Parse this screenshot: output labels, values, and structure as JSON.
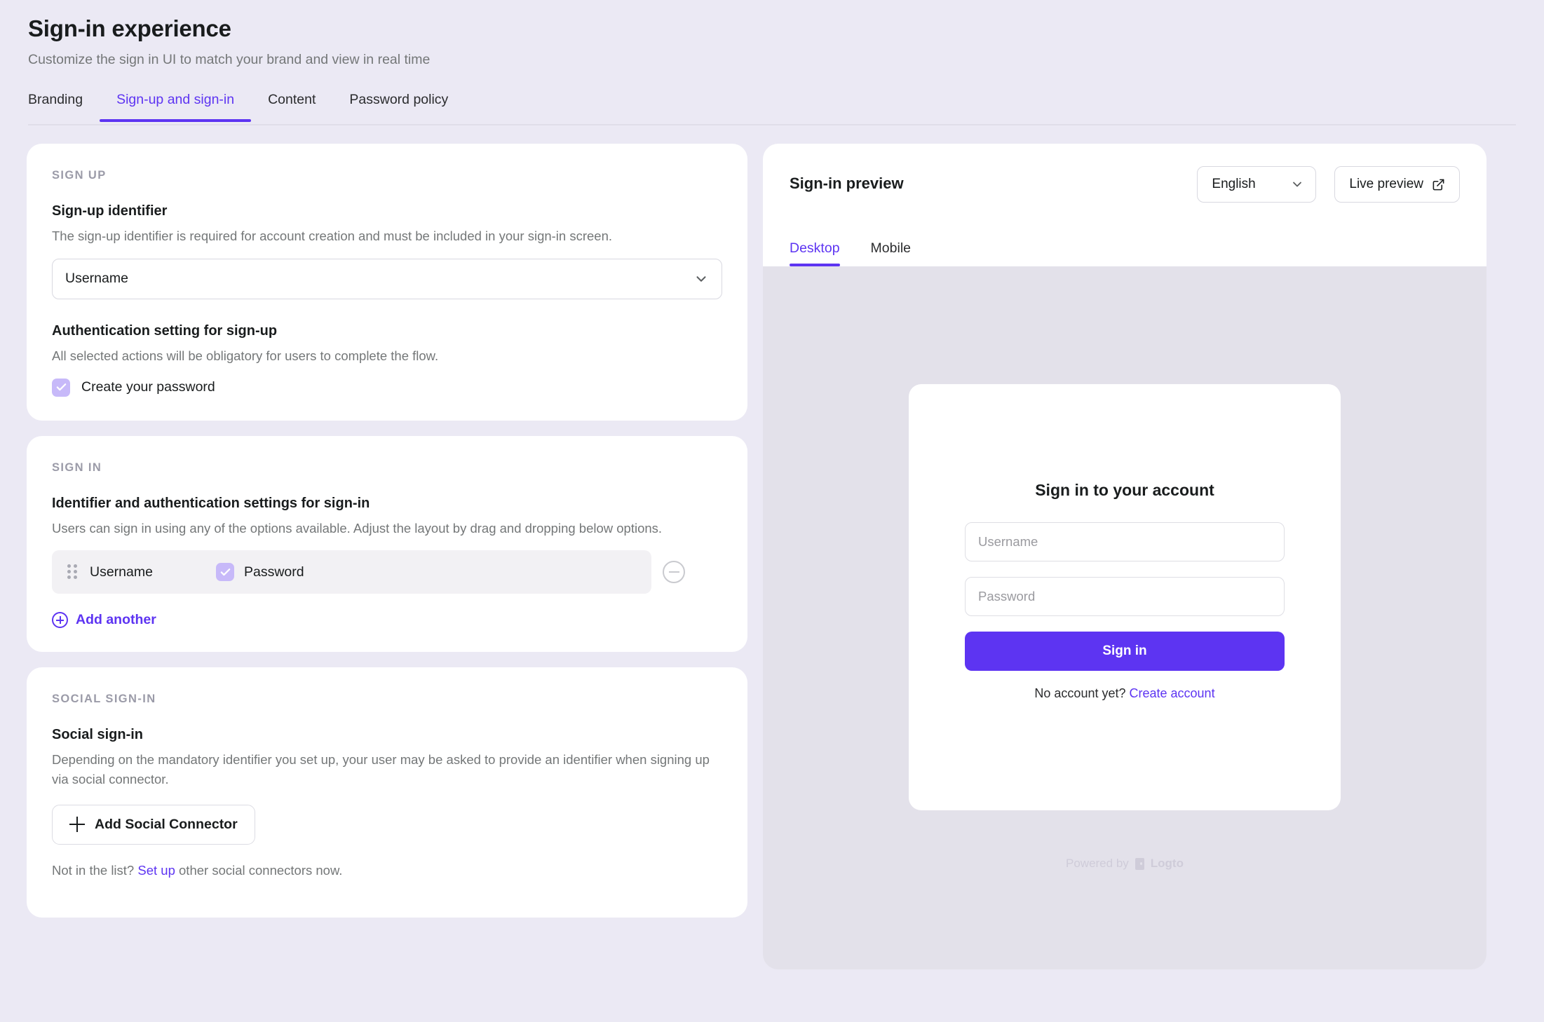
{
  "header": {
    "title": "Sign-in experience",
    "subtitle": "Customize the sign in UI to match your brand and view in real time"
  },
  "tabs": [
    {
      "label": "Branding",
      "active": false
    },
    {
      "label": "Sign-up and sign-in",
      "active": true
    },
    {
      "label": "Content",
      "active": false
    },
    {
      "label": "Password policy",
      "active": false
    }
  ],
  "sign_up": {
    "eyebrow": "SIGN UP",
    "identifier_label": "Sign-up identifier",
    "identifier_desc": "The sign-up identifier is required for account creation and must be included in your sign-in screen.",
    "identifier_value": "Username",
    "auth_label": "Authentication setting for sign-up",
    "auth_desc": "All selected actions will be obligatory for users to complete the flow.",
    "auth_checkbox_label": "Create your password",
    "auth_checkbox_checked": true
  },
  "sign_in": {
    "eyebrow": "SIGN IN",
    "label": "Identifier and authentication settings for sign-in",
    "desc": "Users can sign in using any of the options available. Adjust the layout by drag and dropping below options.",
    "rows": [
      {
        "identifier": "Username",
        "factor_label": "Password",
        "factor_checked": true
      }
    ],
    "add_another": "Add another"
  },
  "social": {
    "eyebrow": "SOCIAL SIGN-IN",
    "label": "Social sign-in",
    "desc": "Depending on the mandatory identifier you set up, your user may be asked to provide an identifier when signing up via social connector.",
    "add_button": "Add Social Connector",
    "footnote_pre": "Not in the list? ",
    "footnote_link": "Set up",
    "footnote_post": " other social connectors now."
  },
  "preview": {
    "title": "Sign-in preview",
    "language": "English",
    "live_preview": "Live preview",
    "tabs": [
      {
        "label": "Desktop",
        "active": true
      },
      {
        "label": "Mobile",
        "active": false
      }
    ],
    "mock": {
      "title": "Sign in to your account",
      "username_placeholder": "Username",
      "password_placeholder": "Password",
      "submit_label": "Sign in",
      "foot_text": "No account yet? ",
      "foot_link": "Create account"
    },
    "powered_by": "Powered by",
    "powered_brand": "Logto"
  },
  "colors": {
    "accent": "#5d34f2",
    "checkbox": "#c7b9f9",
    "page_bg": "#ebe9f4",
    "preview_bg": "#e3e1ea"
  }
}
